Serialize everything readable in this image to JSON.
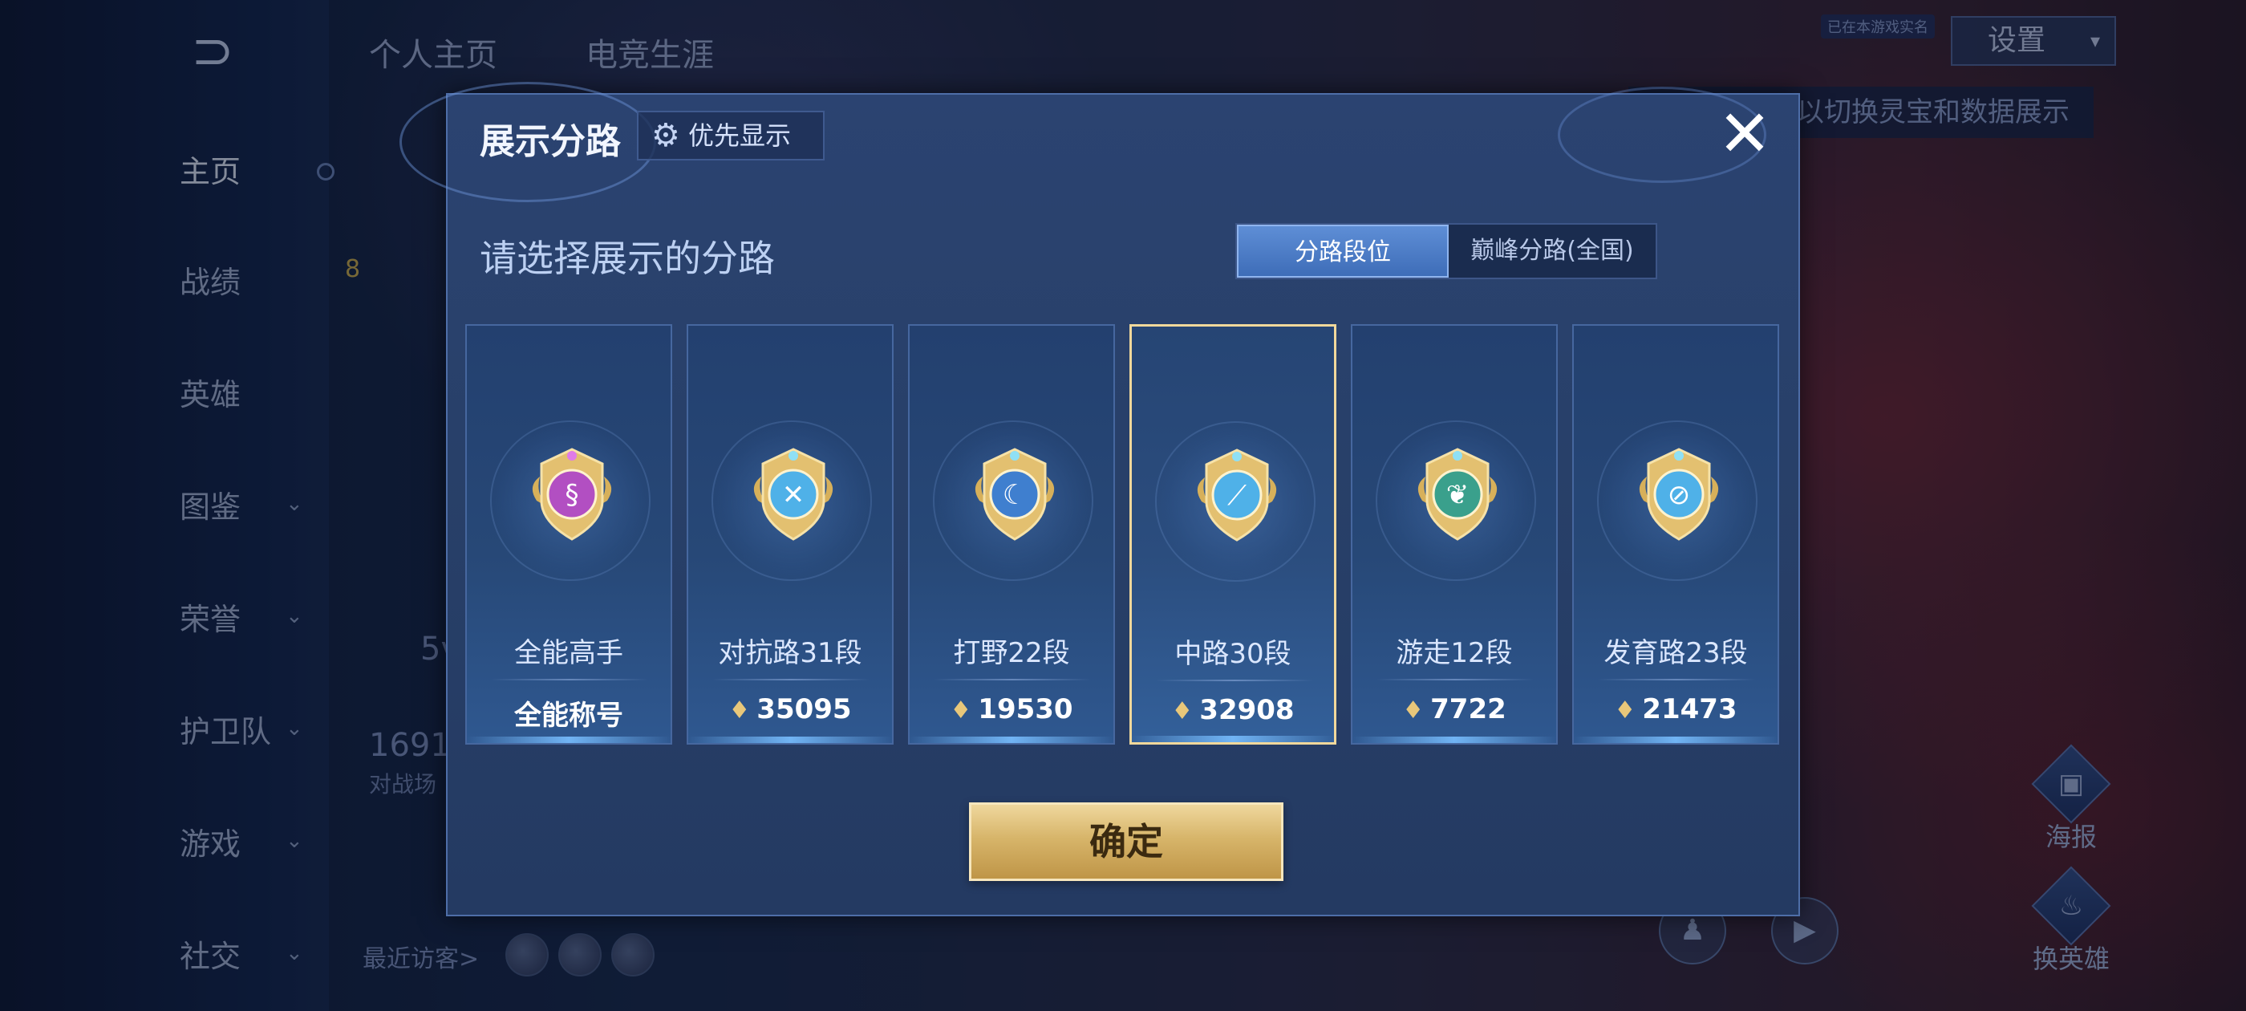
{
  "background": {
    "back_label": "⊃",
    "top_tabs": [
      "个人主页",
      "电竞生涯"
    ],
    "settings_label": "设置",
    "hint_badge": "已在本游戏实名",
    "hint_text": "以切换灵宝和数据展示",
    "nav": [
      {
        "label": "主页",
        "active": true,
        "chevron": false
      },
      {
        "label": "战绩",
        "active": false,
        "chevron": false
      },
      {
        "label": "英雄",
        "active": false,
        "chevron": false
      },
      {
        "label": "图鉴",
        "active": false,
        "chevron": true
      },
      {
        "label": "荣誉",
        "active": false,
        "chevron": true
      },
      {
        "label": "护卫队",
        "active": false,
        "chevron": true
      },
      {
        "label": "游戏",
        "active": false,
        "chevron": true
      },
      {
        "label": "社交",
        "active": false,
        "chevron": true
      }
    ],
    "partial_text_1": "5v",
    "partial_text_2": "1691",
    "partial_text_3": "对战场",
    "partial_text_4": "8",
    "visitors_label": "最近访客>",
    "poster_label": "海报",
    "switch_hero_label": "换英雄"
  },
  "modal": {
    "title": "展示分路",
    "priority_label": "优先显示",
    "subtitle": "请选择展示的分路",
    "segments": {
      "option_a": "分路段位",
      "option_b": "巅峰分路(全国)"
    },
    "cards": [
      {
        "name": "全能高手",
        "value": "全能称号",
        "has_points": false,
        "medal_color": "#b24fc2",
        "medal_icon": "swirl-emblem-icon",
        "selected": false
      },
      {
        "name": "对抗路31段",
        "value": "35095",
        "has_points": true,
        "medal_color": "#4fb1e8",
        "medal_icon": "crossed-swords-icon",
        "selected": false
      },
      {
        "name": "打野22段",
        "value": "19530",
        "has_points": true,
        "medal_color": "#3f7fcf",
        "medal_icon": "dragon-icon",
        "selected": false
      },
      {
        "name": "中路30段",
        "value": "32908",
        "has_points": true,
        "medal_color": "#4fb1e8",
        "medal_icon": "wand-icon",
        "selected": true
      },
      {
        "name": "游走12段",
        "value": "7722",
        "has_points": true,
        "medal_color": "#3aa08c",
        "medal_icon": "wings-icon",
        "selected": false
      },
      {
        "name": "发育路23段",
        "value": "21473",
        "has_points": true,
        "medal_color": "#4fb1e8",
        "medal_icon": "target-icon",
        "selected": false
      }
    ],
    "confirm_label": "确定"
  }
}
